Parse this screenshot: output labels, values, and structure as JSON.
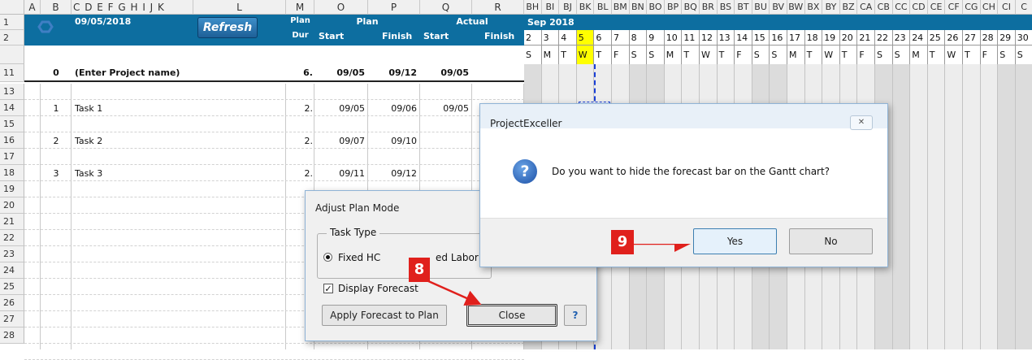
{
  "col_headers": {
    "A": "A",
    "B": "B",
    "CtoK": "C D E F G H I J K",
    "L": "L",
    "M": "M",
    "O": "O",
    "P": "P",
    "Q": "Q",
    "R": "R",
    "gantt": [
      "BH",
      "BI",
      "BJ",
      "BK",
      "BL",
      "BM",
      "BN",
      "BO",
      "BP",
      "BQ",
      "BR",
      "BS",
      "BT",
      "BU",
      "BV",
      "BW",
      "BX",
      "BY",
      "BZ",
      "CA",
      "CB",
      "CC",
      "CD",
      "CE",
      "CF",
      "CG",
      "CH",
      "CI",
      "C"
    ]
  },
  "row_numbers": [
    "1",
    "2",
    "11",
    "13",
    "14",
    "15",
    "16",
    "17",
    "18",
    "19",
    "20",
    "21",
    "22",
    "23",
    "24",
    "25",
    "26",
    "27",
    "28"
  ],
  "header": {
    "date": "09/05/2018",
    "refresh_label": "Refresh",
    "plan_label": "Plan",
    "dur_label": "Dur",
    "plan_group": "Plan",
    "start_label": "Start",
    "finish_label": "Finish",
    "actual_group": "Actual",
    "actual_start": "Start",
    "actual_finish": "Finish",
    "month": "Sep 2018",
    "days": [
      "2",
      "3",
      "4",
      "5",
      "6",
      "7",
      "8",
      "9",
      "10",
      "11",
      "12",
      "13",
      "14",
      "15",
      "16",
      "17",
      "18",
      "19",
      "20",
      "21",
      "22",
      "23",
      "24",
      "25",
      "26",
      "27",
      "28",
      "29",
      "30"
    ],
    "dow": [
      "S",
      "M",
      "T",
      "W",
      "T",
      "F",
      "S",
      "S",
      "M",
      "T",
      "W",
      "T",
      "F",
      "S",
      "S",
      "M",
      "T",
      "W",
      "T",
      "F",
      "S",
      "S",
      "M",
      "T",
      "W",
      "T",
      "F",
      "S",
      "S"
    ],
    "today_color": "#ffff00"
  },
  "project_row": {
    "id": "0",
    "name": "(Enter Project name)",
    "dur": "6.",
    "start": "09/05",
    "finish": "09/12",
    "actual_start": "09/05"
  },
  "tasks": [
    {
      "id": "1",
      "name": "Task 1",
      "dur": "2.",
      "start": "09/05",
      "finish": "09/06",
      "actual_start": "09/05"
    },
    {
      "id": "2",
      "name": "Task 2",
      "dur": "2.",
      "start": "09/07",
      "finish": "09/10",
      "actual_start": ""
    },
    {
      "id": "3",
      "name": "Task 3",
      "dur": "2.",
      "start": "09/11",
      "finish": "09/12",
      "actual_start": ""
    }
  ],
  "adjust_dialog": {
    "title": "Adjust Plan Mode",
    "group_label": "Task Type",
    "fixed_hc": "Fixed HC",
    "fixed_labor": "ed Labor",
    "display_forecast": "Display Forecast",
    "apply_button": "Apply Forecast to Plan",
    "close_button": "Close",
    "help_button": "?"
  },
  "msg_dialog": {
    "title": "ProjectExceller",
    "message": "Do you want to hide the forecast bar on the Gantt chart?",
    "yes": "Yes",
    "no": "No",
    "icon": "question-icon"
  },
  "callouts": {
    "step8": "8",
    "step9": "9"
  },
  "colors": {
    "band": "#0d6ea0",
    "callout": "#e0201c",
    "accent_blue": "#1f5fb0"
  }
}
